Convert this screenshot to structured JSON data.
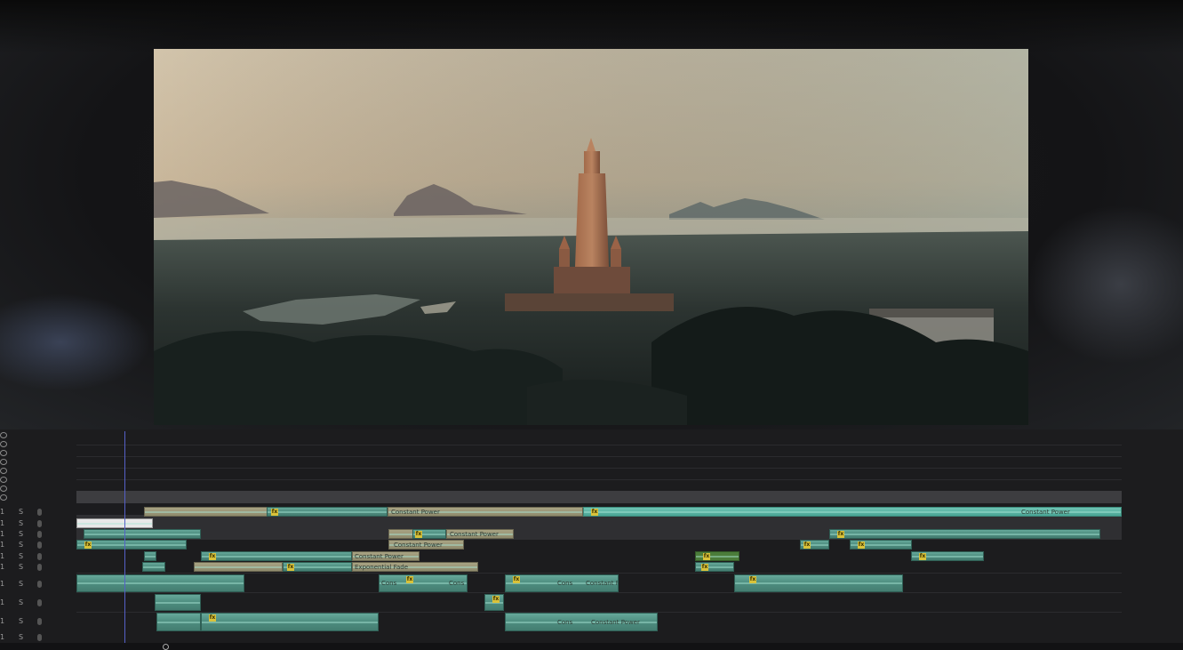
{
  "timeline": {
    "track_rows": [
      {
        "num": "1",
        "solo": "S"
      },
      {
        "num": "1",
        "solo": "S"
      },
      {
        "num": "1",
        "solo": "S"
      },
      {
        "num": "1",
        "solo": "S"
      },
      {
        "num": "1",
        "solo": "S"
      },
      {
        "num": "1",
        "solo": "S"
      },
      {
        "num": "1",
        "solo": "S"
      },
      {
        "num": "1",
        "solo": "S"
      },
      {
        "num": "1",
        "solo": "S"
      },
      {
        "num": "1",
        "solo": "S"
      }
    ],
    "clip_labels": {
      "a1_long": "Constant Power",
      "a1_tail": "Constant Power",
      "a3_mid": "Constant Power",
      "a4_mid": "Constant Power",
      "a5_mid": "Constant Power",
      "a6_mid": "Exponential Fade",
      "a7_a": "Cons",
      "a7_b": "Cons",
      "a7_c": "Cons",
      "a7_d": "Constant P",
      "a9_a": "Cons",
      "a9_b": "Constant Power"
    },
    "fx_badge": "fx"
  },
  "icons": {
    "eye": "eye-icon",
    "mic": "microphone-icon"
  },
  "colors": {
    "audio_clip": "#4f8f81",
    "playhead": "#5560c8",
    "fx_badge": "#d9c23a"
  }
}
